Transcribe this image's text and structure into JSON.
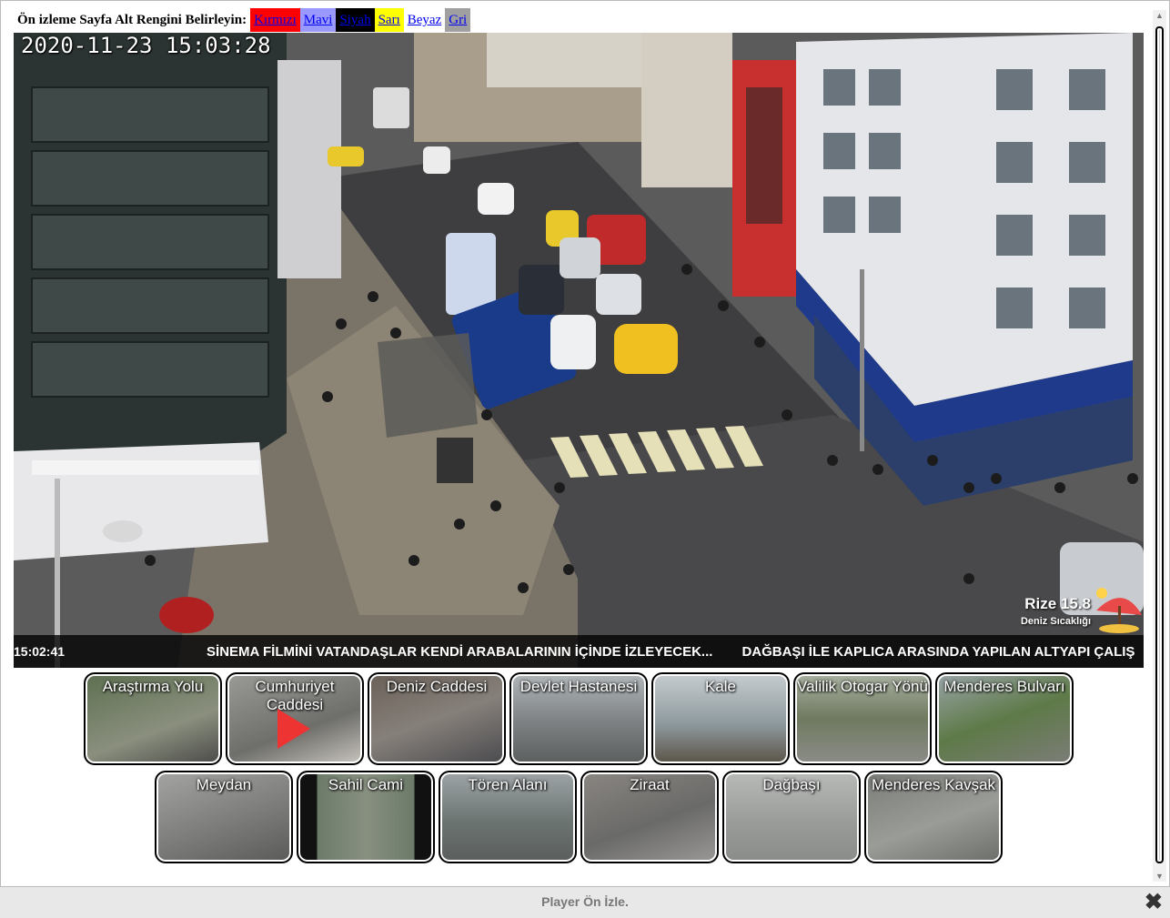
{
  "colorbar": {
    "label": "Ön izleme Sayfa Alt Rengini Belirleyin:",
    "options": [
      {
        "label": "Kırmızı",
        "bg": "#ff0000"
      },
      {
        "label": "Mavi",
        "bg": "#9999ff"
      },
      {
        "label": "Siyah",
        "bg": "#000000"
      },
      {
        "label": "Sarı",
        "bg": "#ffff00"
      },
      {
        "label": "Beyaz",
        "bg": "#ffffff"
      },
      {
        "label": "Gri",
        "bg": "#a0a0a0"
      }
    ]
  },
  "player": {
    "timestamp": "2020-11-23 15:03:28",
    "weather_temp": "Rize 15.8",
    "weather_sub": "Deniz Sıcaklığı",
    "clock": "15:02:41",
    "news": [
      "SİNEMA FİLMİNİ VATANDAŞLAR KENDİ ARABALARININ İÇİNDE İZLEYECEK...",
      "DAĞBAŞI İLE KAPLICA ARASINDA YAPILAN ALTYAPI ÇALIŞ"
    ]
  },
  "cameras": {
    "row1": [
      {
        "label": "Araştırma Yolu",
        "theme": "#6a7a5a"
      },
      {
        "label": "Cumhuriyet Caddesi",
        "theme": "#8a8a86"
      },
      {
        "label": "Deniz Caddesi",
        "theme": "#77706a"
      },
      {
        "label": "Devlet Hastanesi",
        "theme": "#8c8f90"
      },
      {
        "label": "Kale",
        "theme": "#9aa3a6"
      },
      {
        "label": "Valilik Otogar Yönü",
        "theme": "#8a9080"
      },
      {
        "label": "Menderes Bulvarı",
        "theme": "#7b8a70"
      }
    ],
    "row2": [
      {
        "label": "Meydan",
        "theme": "#8e8e8c"
      },
      {
        "label": "Sahil Cami",
        "theme": "#6c7a6a"
      },
      {
        "label": "Tören Alanı",
        "theme": "#7c8280"
      },
      {
        "label": "Ziraat",
        "theme": "#80807c"
      },
      {
        "label": "Dağbaşı",
        "theme": "#a8aaa8"
      },
      {
        "label": "Menderes Kavşak",
        "theme": "#8a8c88"
      }
    ]
  },
  "footer": {
    "label": "Player Ön İzle.",
    "close": "✖"
  }
}
